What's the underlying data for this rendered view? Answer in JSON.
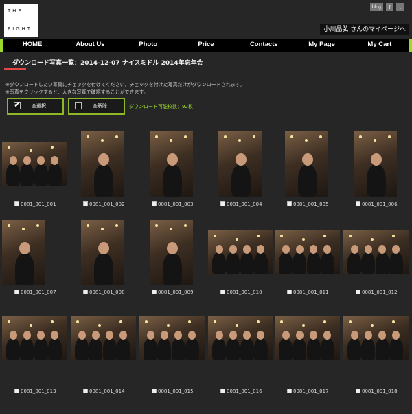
{
  "brand": {
    "line1": "THE",
    "line2": "FIGHT"
  },
  "social": {
    "blog": "blog",
    "facebook": "f",
    "twitter": "t"
  },
  "mypage_link": "小川晶弘 さんのマイページへ",
  "nav": [
    "HOME",
    "About Us",
    "Photo",
    "Price",
    "Contacts",
    "My Page",
    "My Cart"
  ],
  "heading": "ダウンロード写真一覧：2014-12-07 ナイスミドル 2014年忘年会",
  "notes": [
    "※ダウンロードしたい写真にチェックを付けてください。チェックを付けた写真だけがダウンロードされます。",
    "※写真をクリックすると、大きな写真で確認することができます。"
  ],
  "buttons": {
    "select_all": "全選択",
    "deselect_all": "全解除"
  },
  "download_limit": "ダウンロード可能枚数：92枚",
  "photos": [
    "0081_001_001",
    "0081_001_002",
    "0081_001_003",
    "0081_001_004",
    "0081_001_005",
    "0081_001_006",
    "0081_001_007",
    "0081_001_008",
    "0081_001_009",
    "0081_001_010",
    "0081_001_011",
    "0081_001_012",
    "0081_001_013",
    "0081_001_014",
    "0081_001_015",
    "0081_001_016",
    "0081_001_017",
    "0081_001_018"
  ]
}
